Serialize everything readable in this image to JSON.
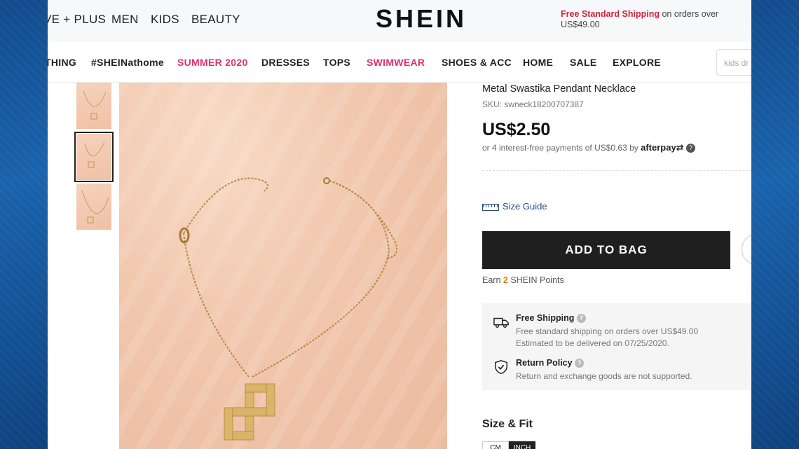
{
  "top_categories": [
    "VE + PLUS",
    "MEN",
    "KIDS",
    "BEAUTY"
  ],
  "brand": "SHEIN",
  "shipping_banner": {
    "highlight": "Free Standard Shipping",
    "rest": " on orders over US$49.00"
  },
  "nav": [
    "THING",
    "#SHEINathome",
    "SUMMER 2020",
    "DRESSES",
    "TOPS",
    "SWIMWEAR",
    "SHOES & ACC",
    "HOME",
    "SALE",
    "EXPLORE"
  ],
  "nav_highlight_color": "#e0306f",
  "search": {
    "placeholder": "kids dr"
  },
  "product": {
    "title": "Metal Swastika Pendant Necklace",
    "sku": "SKU: swneck18200707387",
    "price": "US$2.50",
    "installments_text": "or 4 interest-free payments of US$0.63 by ",
    "afterpay_label": "afterpay",
    "size_guide": "Size Guide",
    "add_to_bag": "ADD TO BAG",
    "points_prefix": "Earn ",
    "points_value": "2",
    "points_suffix": " SHEIN Points"
  },
  "shipping_info": {
    "title": "Free Shipping",
    "line1": "Free standard shipping on orders over US$49.00",
    "line2": "Estimated to be delivered on 07/25/2020."
  },
  "return_policy": {
    "title": "Return Policy",
    "text": "Return and exchange goods are not supported."
  },
  "size_fit": {
    "heading": "Size & Fit",
    "units": [
      "CM",
      "INCH"
    ],
    "active_unit": "INCH"
  },
  "gallery": {
    "thumbnail_count": 3,
    "selected_index": 1
  },
  "colors": {
    "accent_red": "#d0243b",
    "points_orange": "#f27a0a",
    "button_black": "#1f1f1f"
  }
}
